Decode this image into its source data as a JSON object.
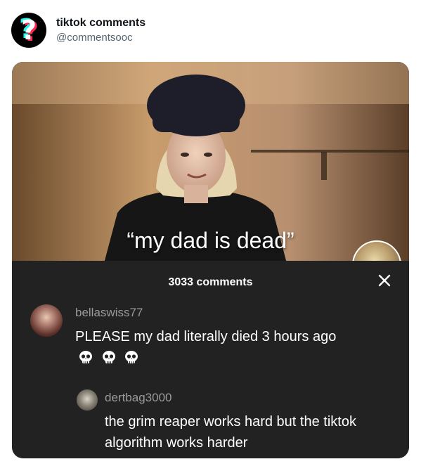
{
  "tweet": {
    "display_name": "tiktok comments",
    "handle": "@commentsooc",
    "avatar_icon": "question-mark-icon",
    "avatar_glyph": "?"
  },
  "video": {
    "caption": "“my dad is dead”"
  },
  "comments_panel": {
    "title": "3033 comments",
    "close_icon": "close-icon",
    "comments": [
      {
        "username": "bellaswiss77",
        "text": "PLEASE my dad literally died 3 hours ago",
        "emoji": [
          "skull-emoji",
          "skull-emoji",
          "skull-emoji"
        ]
      }
    ],
    "replies": [
      {
        "username": "dertbag3000",
        "text": "the grim reaper works hard but the tiktok algorithm works harder"
      }
    ]
  }
}
